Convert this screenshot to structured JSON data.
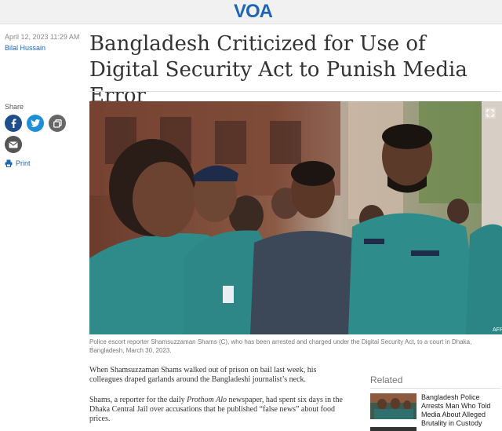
{
  "header": {
    "logo_text": "VOA",
    "brand_color": "#1e66b5"
  },
  "article": {
    "date": "April 12, 2023 11:29 AM",
    "author": "Bilal Hussain",
    "title": "Bangladesh Criticized for Use of Digital Security Act to Punish Media Error",
    "caption": "Police escort reporter Shamsuzzaman Shams (C), who has been arrested and charged under the Digital Security Act, to a court in Dhaka, Bangladesh, March 30, 2023.",
    "credit": "AFP",
    "p1": "When Shamsuzzaman Shams walked out of prison on bail last week, his colleagues draped garlands around the Bangladeshi journalist’s neck.",
    "p2_before": "Shams, a reporter for the daily ",
    "p2_em": "Prothom Alo",
    "p2_after": " newspaper, had spent six days in the Dhaka Central Jail over accusations that he published “false news” about food prices."
  },
  "share": {
    "label": "Share",
    "print_label": "Print",
    "icons": [
      "facebook-icon",
      "twitter-icon",
      "copy-link-icon",
      "email-icon",
      "print-icon"
    ]
  },
  "related": {
    "heading": "Related",
    "items": [
      {
        "title": "Bangladesh Police Arrests Man Who Told Media About Alleged Brutality in Custody"
      }
    ]
  }
}
